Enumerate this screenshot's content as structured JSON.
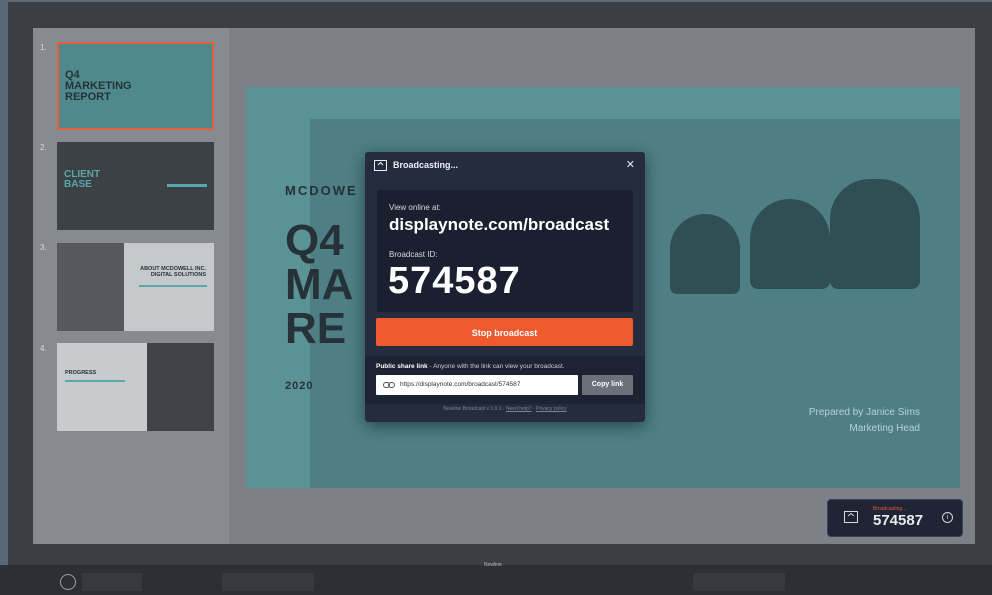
{
  "device": {
    "brand": "Newline"
  },
  "sidebar": {
    "thumbnails": [
      {
        "number": "1.",
        "title": "Q4\nMARKETING\nREPORT"
      },
      {
        "number": "2.",
        "title": "CLIENT\nBASE"
      },
      {
        "number": "3.",
        "title": "ABOUT MCDOWELL INC.\nDIGITAL SOLUTIONS"
      },
      {
        "number": "4.",
        "title": "PROGRESS"
      }
    ]
  },
  "slide": {
    "company": "MCDOWE",
    "title": "Q4\nMA\nRE",
    "year": "2020",
    "prepared_by": "Prepared by Janice Sims",
    "role": "Marketing Head"
  },
  "dialog": {
    "title": "Broadcasting...",
    "view_online_label": "View online at:",
    "url": "displaynote.com/broadcast",
    "broadcast_id_label": "Broadcast ID:",
    "broadcast_id": "574587",
    "stop_label": "Stop broadcast",
    "share_label": "Public share link",
    "share_hint": " - Anyone with the link can view your broadcast.",
    "share_link": "https://displaynote.com/broadcast/574587",
    "copy_label": "Copy link",
    "footer_version": "Newline Broadcast v 1.0.1",
    "footer_help": "Need help?",
    "footer_privacy": "Privacy policy"
  },
  "mini_widget": {
    "status": "Broadcasting...",
    "id": "574587"
  },
  "colors": {
    "accent": "#ee5a2e",
    "dialog_bg": "#252c3d",
    "slide_teal": "#5a9296"
  }
}
